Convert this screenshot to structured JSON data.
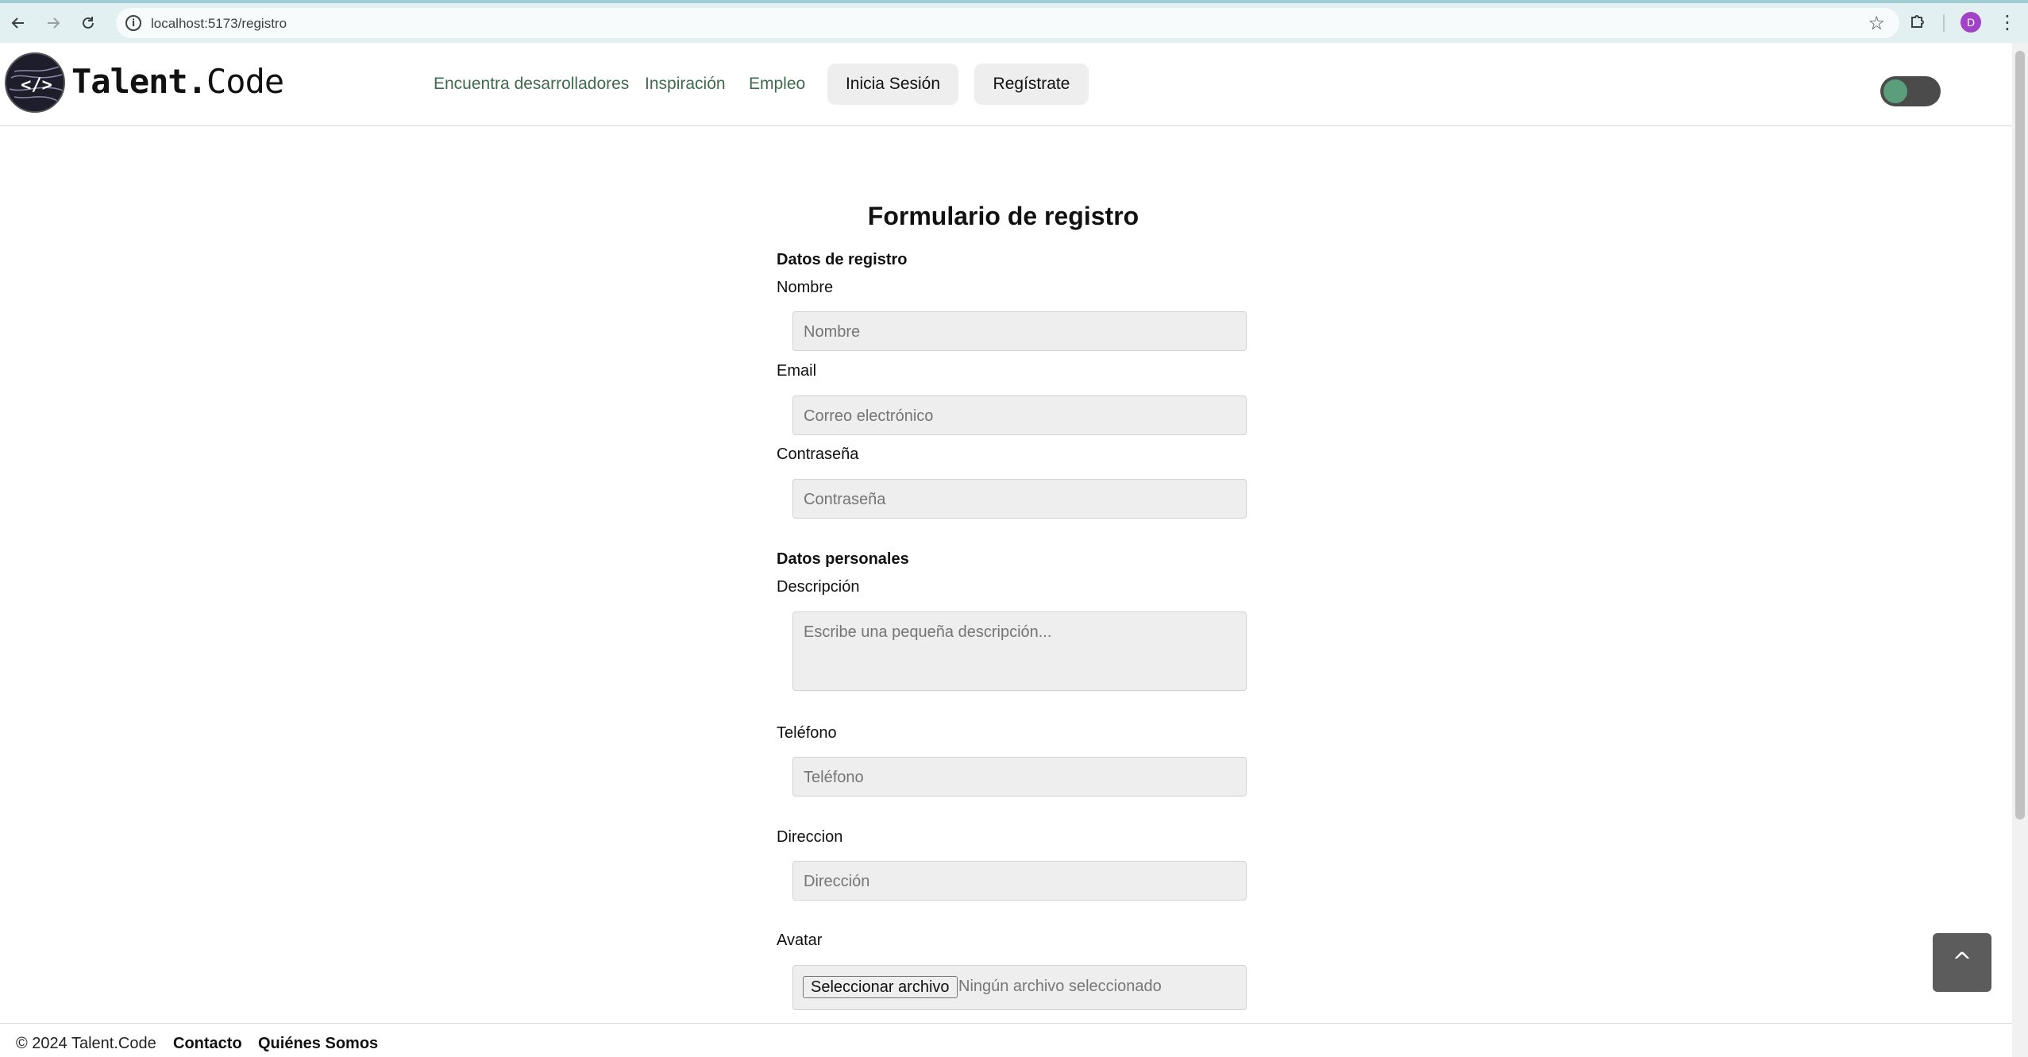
{
  "browser": {
    "url": "localhost:5173/registro",
    "profile_initial": "D"
  },
  "header": {
    "logo": {
      "bold": "Talent.",
      "regular": "Code"
    },
    "nav": [
      {
        "label": "Encuentra desarrolladores"
      },
      {
        "label": "Inspiración"
      },
      {
        "label": "Empleo"
      }
    ],
    "login_label": "Inicia Sesión",
    "register_label": "Regístrate",
    "theme_toggle_on": true
  },
  "form": {
    "title": "Formulario de registro",
    "section_registro": "Datos de registro",
    "section_personales": "Datos personales",
    "fields": {
      "nombre": {
        "label": "Nombre",
        "placeholder": "Nombre"
      },
      "email": {
        "label": "Email",
        "placeholder": "Correo electrónico"
      },
      "password": {
        "label": "Contraseña",
        "placeholder": "Contraseña"
      },
      "descripcion": {
        "label": "Descripción",
        "placeholder": "Escribe una pequeña descripción..."
      },
      "telefono": {
        "label": "Teléfono",
        "placeholder": "Teléfono"
      },
      "direccion": {
        "label": "Direccion",
        "placeholder": "Dirección"
      },
      "avatar": {
        "label": "Avatar",
        "button": "Seleccionar archivo",
        "status": "Ningún archivo seleccionado"
      }
    }
  },
  "back_to_top_label": "^",
  "footer": {
    "copyright": "© 2024 Talent.Code",
    "links": [
      {
        "label": "Contacto"
      },
      {
        "label": "Quiénes Somos"
      }
    ]
  },
  "colors": {
    "nav_link": "#3e6b4d",
    "toggle_knob": "#5a9e7c",
    "input_bg": "#eeeeee",
    "browser_bar": "#e3f0f2"
  }
}
